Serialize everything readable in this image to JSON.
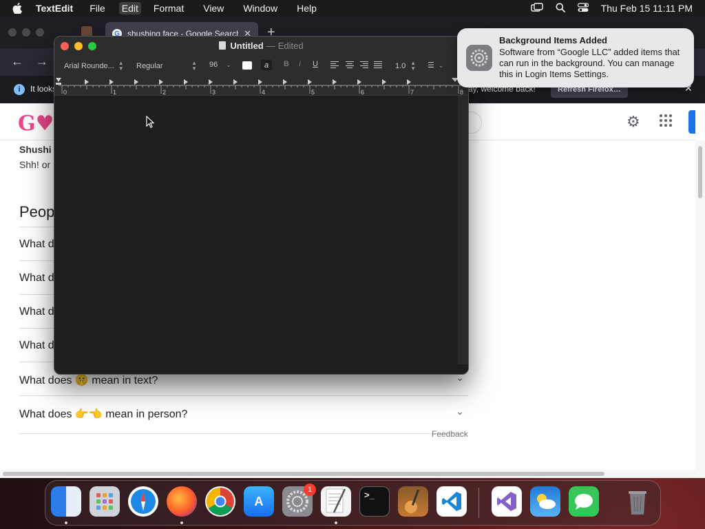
{
  "menubar": {
    "app_name": "TextEdit",
    "menus": [
      "File",
      "Edit",
      "Format",
      "View",
      "Window",
      "Help"
    ],
    "active_menu": "Edit",
    "clock": "Thu Feb 15  11:11 PM",
    "status_icons": [
      "screen-mirroring-icon",
      "search-icon",
      "control-center-icon"
    ]
  },
  "firefox": {
    "tab_title": "shushing face - Google Search",
    "infobar_text": "It looks",
    "infobar_welcome": "ay, welcome back!",
    "refresh_label": "Refresh Firefox…",
    "google": {
      "snippet_title": "Shushi",
      "snippet_text": "Shh! or",
      "paa_heading": "Peop",
      "questions": [
        "What d",
        "What d",
        "What d",
        "What d",
        "What does 🤫 mean in text?",
        "What does 👉👈 mean in person?"
      ],
      "feedback_label": "Feedback"
    }
  },
  "textedit": {
    "doc_name": "Untitled",
    "separator": "—",
    "status": "Edited",
    "font_family": "Arial Rounde...",
    "font_style": "Regular",
    "font_size": "96",
    "highlight_glyph": "a",
    "bold_glyph": "B",
    "italic_glyph": "I",
    "underline_glyph": "U",
    "line_spacing": "1.0",
    "ruler_numbers": [
      "0",
      "1",
      "2",
      "3",
      "4",
      "5",
      "6",
      "7",
      "8"
    ]
  },
  "notification": {
    "title": "Background Items Added",
    "body": "Software from “Google LLC” added items that can run in the background. You can manage this in Login Items Settings."
  },
  "dock": {
    "apps": [
      "Finder",
      "Launchpad",
      "Safari",
      "Firefox",
      "Chrome",
      "App Store",
      "System Settings",
      "TextEdit",
      "Terminal",
      "GarageBand",
      "VS Code",
      "Visual Studio",
      "Weather",
      "Messages",
      "Trash"
    ],
    "settings_badge": "1"
  },
  "colors": {
    "accent_blue": "#1a73e8",
    "traffic_red": "#ff5f57",
    "traffic_yellow": "#febc2e",
    "traffic_green": "#28c840"
  }
}
